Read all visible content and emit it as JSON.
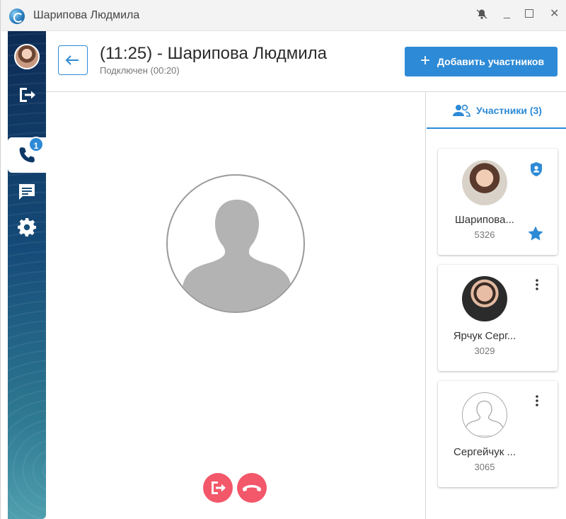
{
  "window": {
    "title": "Шарипова Людмила"
  },
  "sidebar": {
    "call_badge": "1"
  },
  "header": {
    "call_title": "(11:25) - Шарипова Людмила",
    "call_status": "Подключен (00:20)",
    "add_button_label": "Добавить участников",
    "add_button_plus": "+"
  },
  "participants_tab": {
    "label": "Участники (3)"
  },
  "participants": [
    {
      "name": "Шарипова...",
      "number": "5326"
    },
    {
      "name": "Ярчук Серг...",
      "number": "3029"
    },
    {
      "name": "Сергейчук ...",
      "number": "3065"
    }
  ],
  "colors": {
    "accent": "#2d8ad6",
    "danger": "#f3576a",
    "glow": "#ff7a5c"
  },
  "icons": {
    "titlebar": [
      "app-logo-icon",
      "notification-icon",
      "minimize-icon",
      "maximize-icon",
      "close-icon"
    ],
    "sidebar": [
      "avatar",
      "logout-icon",
      "phone-icon",
      "chat-icon",
      "gear-icon"
    ],
    "controls": [
      "leave-call-icon",
      "hangup-icon"
    ]
  }
}
